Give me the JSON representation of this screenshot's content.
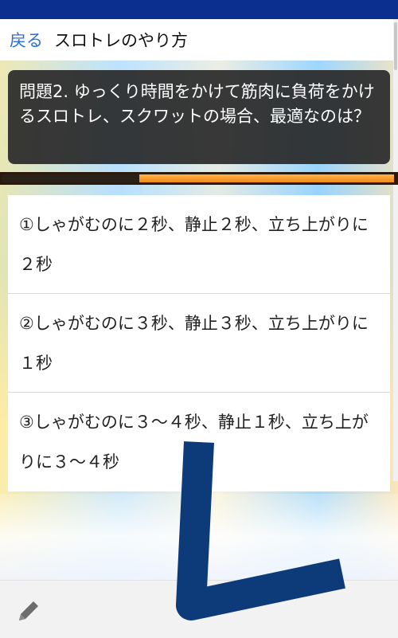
{
  "header": {
    "back_label": "戻る",
    "title": "スロトレのやり方"
  },
  "question": {
    "text": "問題2. ゆっくり時間をかけて筋肉に負荷をかけるスロトレ、スクワットの場合、最適なのは？"
  },
  "progress": {
    "fraction": 0.35
  },
  "choices": [
    "①しゃがむのに２秒、静止２秒、立ち上がりに２秒",
    "②しゃがむのに３秒、静止３秒、立ち上がりに１秒",
    "③しゃがむのに３～４秒、静止１秒、立ち上がりに３～４秒"
  ],
  "colors": {
    "status_bar": "#0b2f8f",
    "link": "#2a6fd0",
    "overlay_mark": "#0d3a78"
  },
  "icons": {
    "bottom_left": "pencil-icon"
  }
}
